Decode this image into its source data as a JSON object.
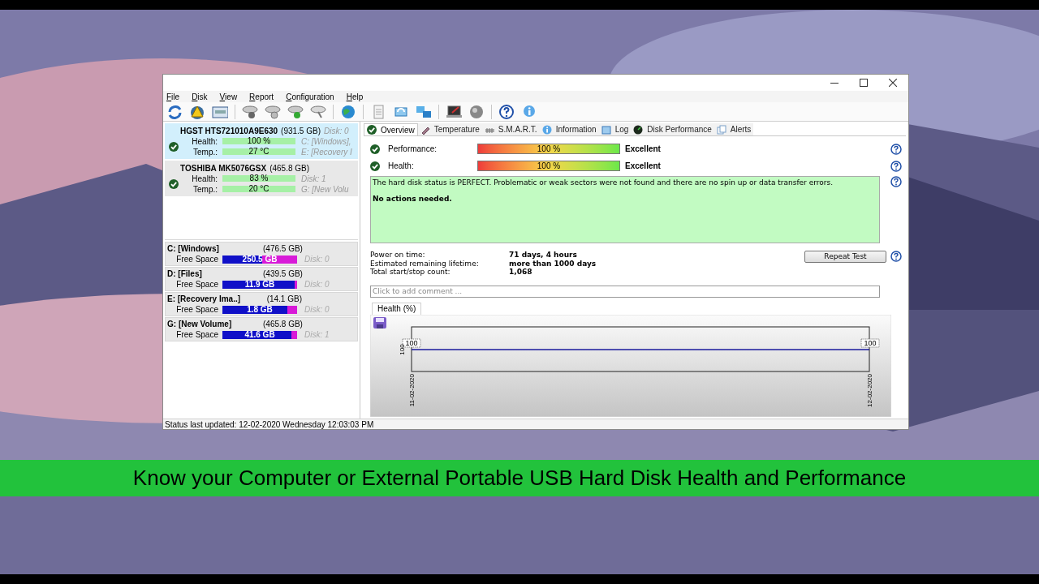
{
  "menu": [
    {
      "label": "File"
    },
    {
      "label": "Disk"
    },
    {
      "label": "View"
    },
    {
      "label": "Report"
    },
    {
      "label": "Configuration"
    },
    {
      "label": "Help"
    }
  ],
  "disks": [
    {
      "name": "HGST HTS721010A9E630",
      "size": "(931.5 GB)",
      "title_note": "Disk: 0",
      "selected": true,
      "health_label": "Health:",
      "health": "100 %",
      "health_note": "C: [Windows],",
      "temp_label": "Temp.:",
      "temp": "27 °C",
      "temp_note": "E: [Recovery I"
    },
    {
      "name": "TOSHIBA MK5076GSX",
      "size": "(465.8 GB)",
      "selected": false,
      "health_label": "Health:",
      "health": "83 %",
      "health_note": "Disk: 1",
      "temp_label": "Temp.:",
      "temp": "20 °C",
      "temp_note": "G: [New Volu"
    }
  ],
  "volumes": [
    {
      "name": "C: [Windows]",
      "size": "(476.5 GB)",
      "label": "Free Space",
      "free": "250.5 GB",
      "level": 0.53,
      "disk": "Disk: 0"
    },
    {
      "name": "D: [Files]",
      "size": "(439.5 GB)",
      "label": "Free Space",
      "free": "11.9 GB",
      "level": 0.97,
      "disk": "Disk: 0"
    },
    {
      "name": "E: [Recovery Ima..]",
      "size": "(14.1 GB)",
      "label": "Free Space",
      "free": "1.8 GB",
      "level": 0.87,
      "disk": "Disk: 0"
    },
    {
      "name": "G: [New Volume]",
      "size": "(465.8 GB)",
      "label": "Free Space",
      "free": "41.6 GB",
      "level": 0.92,
      "disk": "Disk: 1"
    }
  ],
  "tabs": [
    {
      "label": "Overview",
      "kind": "check",
      "selected": true
    },
    {
      "label": "Temperature",
      "kind": "thermo",
      "selected": false
    },
    {
      "label": "S.M.A.R.T.",
      "kind": "smart",
      "selected": false
    },
    {
      "label": "Information",
      "kind": "info",
      "selected": false
    },
    {
      "label": "Log",
      "kind": "log",
      "selected": false
    },
    {
      "label": "Disk Performance",
      "kind": "gauge",
      "selected": false
    },
    {
      "label": "Alerts",
      "kind": "alerts",
      "selected": false
    }
  ],
  "metrics": [
    {
      "label": "Performance:",
      "value": "100 %",
      "level": 1,
      "rating": "Excellent"
    },
    {
      "label": "Health:",
      "value": "100 %",
      "level": 1,
      "rating": "Excellent"
    }
  ],
  "status_message": "The hard disk status is PERFECT. Problematic or weak sectors were not found and there are no spin up or data transfer errors.",
  "status_action": "No actions needed.",
  "info": [
    {
      "label": "Power on time:",
      "value": "71 days, 4 hours"
    },
    {
      "label": "Estimated remaining lifetime:",
      "value": "more than 1000 days"
    },
    {
      "label": "Total start/stop count:",
      "value": "1,068"
    }
  ],
  "repeat_button": "Repeat Test",
  "comment": {
    "placeholder": "Click to add comment ..."
  },
  "health_chart": {
    "tab": "Health (%)",
    "y_tick": "100",
    "point_labels": [
      "100",
      "100"
    ],
    "dates": [
      "11-02-2020",
      "12-02-2020"
    ]
  },
  "status_bar": "Status last updated: 12-02-2020 Wednesday 12:03:03 PM",
  "caption": "Know your Computer or External Portable USB Hard Disk Health and Performance"
}
